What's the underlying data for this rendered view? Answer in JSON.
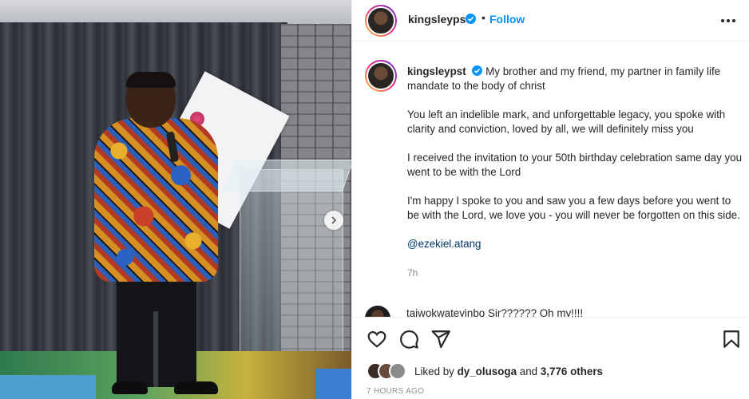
{
  "post": {
    "author": "kingsleypst",
    "follow_label": "Follow",
    "separator": "•",
    "caption_paragraphs": [
      "My brother and my friend, my partner in family life mandate to the body of christ",
      "You left an indelible mark, and unforgettable legacy, you spoke with clarity and conviction, loved by all, we will definitely miss you",
      "I received the invitation to your 50th birthday celebration same day you went to be with the Lord",
      "I'm happy I spoke to you and saw you a few days before you went to be with the Lord, we love you - you will never be forgotten on this side."
    ],
    "mention": "@ezekiel.atang",
    "caption_age": "7h",
    "comment_preview": "taiwokwateyinbo Sir?????? Oh my!!!!",
    "liked_prefix": "Liked by",
    "liked_user": "dy_olusoga",
    "liked_and": "and",
    "liked_count": "3,776 others",
    "timestamp": "7 HOURS AGO"
  },
  "icons": {
    "verified": "verified-badge-icon",
    "more": "more-options-icon",
    "like": "heart-icon",
    "comment": "comment-icon",
    "share": "send-icon",
    "save": "bookmark-icon",
    "next": "chevron-right-icon"
  },
  "colors": {
    "link": "#0095f6",
    "mention": "#00376b",
    "muted": "#8e8e8e",
    "text": "#262626"
  }
}
